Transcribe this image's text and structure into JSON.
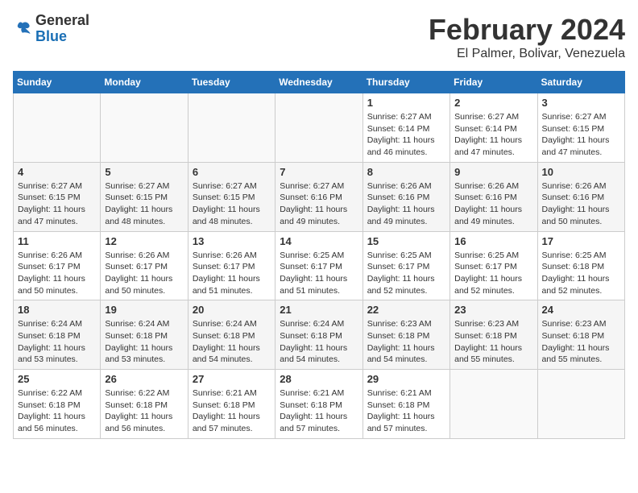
{
  "header": {
    "logo_general": "General",
    "logo_blue": "Blue",
    "month_title": "February 2024",
    "location": "El Palmer, Bolivar, Venezuela"
  },
  "days_of_week": [
    "Sunday",
    "Monday",
    "Tuesday",
    "Wednesday",
    "Thursday",
    "Friday",
    "Saturday"
  ],
  "weeks": [
    [
      {
        "day": "",
        "info": ""
      },
      {
        "day": "",
        "info": ""
      },
      {
        "day": "",
        "info": ""
      },
      {
        "day": "",
        "info": ""
      },
      {
        "day": "1",
        "info": "Sunrise: 6:27 AM\nSunset: 6:14 PM\nDaylight: 11 hours\nand 46 minutes."
      },
      {
        "day": "2",
        "info": "Sunrise: 6:27 AM\nSunset: 6:14 PM\nDaylight: 11 hours\nand 47 minutes."
      },
      {
        "day": "3",
        "info": "Sunrise: 6:27 AM\nSunset: 6:15 PM\nDaylight: 11 hours\nand 47 minutes."
      }
    ],
    [
      {
        "day": "4",
        "info": "Sunrise: 6:27 AM\nSunset: 6:15 PM\nDaylight: 11 hours\nand 47 minutes."
      },
      {
        "day": "5",
        "info": "Sunrise: 6:27 AM\nSunset: 6:15 PM\nDaylight: 11 hours\nand 48 minutes."
      },
      {
        "day": "6",
        "info": "Sunrise: 6:27 AM\nSunset: 6:15 PM\nDaylight: 11 hours\nand 48 minutes."
      },
      {
        "day": "7",
        "info": "Sunrise: 6:27 AM\nSunset: 6:16 PM\nDaylight: 11 hours\nand 49 minutes."
      },
      {
        "day": "8",
        "info": "Sunrise: 6:26 AM\nSunset: 6:16 PM\nDaylight: 11 hours\nand 49 minutes."
      },
      {
        "day": "9",
        "info": "Sunrise: 6:26 AM\nSunset: 6:16 PM\nDaylight: 11 hours\nand 49 minutes."
      },
      {
        "day": "10",
        "info": "Sunrise: 6:26 AM\nSunset: 6:16 PM\nDaylight: 11 hours\nand 50 minutes."
      }
    ],
    [
      {
        "day": "11",
        "info": "Sunrise: 6:26 AM\nSunset: 6:17 PM\nDaylight: 11 hours\nand 50 minutes."
      },
      {
        "day": "12",
        "info": "Sunrise: 6:26 AM\nSunset: 6:17 PM\nDaylight: 11 hours\nand 50 minutes."
      },
      {
        "day": "13",
        "info": "Sunrise: 6:26 AM\nSunset: 6:17 PM\nDaylight: 11 hours\nand 51 minutes."
      },
      {
        "day": "14",
        "info": "Sunrise: 6:25 AM\nSunset: 6:17 PM\nDaylight: 11 hours\nand 51 minutes."
      },
      {
        "day": "15",
        "info": "Sunrise: 6:25 AM\nSunset: 6:17 PM\nDaylight: 11 hours\nand 52 minutes."
      },
      {
        "day": "16",
        "info": "Sunrise: 6:25 AM\nSunset: 6:17 PM\nDaylight: 11 hours\nand 52 minutes."
      },
      {
        "day": "17",
        "info": "Sunrise: 6:25 AM\nSunset: 6:18 PM\nDaylight: 11 hours\nand 52 minutes."
      }
    ],
    [
      {
        "day": "18",
        "info": "Sunrise: 6:24 AM\nSunset: 6:18 PM\nDaylight: 11 hours\nand 53 minutes."
      },
      {
        "day": "19",
        "info": "Sunrise: 6:24 AM\nSunset: 6:18 PM\nDaylight: 11 hours\nand 53 minutes."
      },
      {
        "day": "20",
        "info": "Sunrise: 6:24 AM\nSunset: 6:18 PM\nDaylight: 11 hours\nand 54 minutes."
      },
      {
        "day": "21",
        "info": "Sunrise: 6:24 AM\nSunset: 6:18 PM\nDaylight: 11 hours\nand 54 minutes."
      },
      {
        "day": "22",
        "info": "Sunrise: 6:23 AM\nSunset: 6:18 PM\nDaylight: 11 hours\nand 54 minutes."
      },
      {
        "day": "23",
        "info": "Sunrise: 6:23 AM\nSunset: 6:18 PM\nDaylight: 11 hours\nand 55 minutes."
      },
      {
        "day": "24",
        "info": "Sunrise: 6:23 AM\nSunset: 6:18 PM\nDaylight: 11 hours\nand 55 minutes."
      }
    ],
    [
      {
        "day": "25",
        "info": "Sunrise: 6:22 AM\nSunset: 6:18 PM\nDaylight: 11 hours\nand 56 minutes."
      },
      {
        "day": "26",
        "info": "Sunrise: 6:22 AM\nSunset: 6:18 PM\nDaylight: 11 hours\nand 56 minutes."
      },
      {
        "day": "27",
        "info": "Sunrise: 6:21 AM\nSunset: 6:18 PM\nDaylight: 11 hours\nand 57 minutes."
      },
      {
        "day": "28",
        "info": "Sunrise: 6:21 AM\nSunset: 6:18 PM\nDaylight: 11 hours\nand 57 minutes."
      },
      {
        "day": "29",
        "info": "Sunrise: 6:21 AM\nSunset: 6:18 PM\nDaylight: 11 hours\nand 57 minutes."
      },
      {
        "day": "",
        "info": ""
      },
      {
        "day": "",
        "info": ""
      }
    ]
  ]
}
